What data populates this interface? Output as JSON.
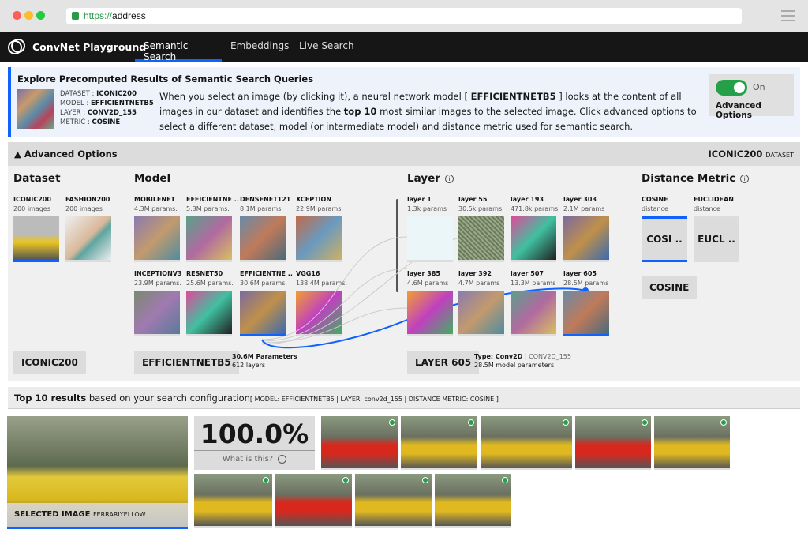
{
  "browser": {
    "url_scheme": "https://",
    "url_host": "address"
  },
  "nav": {
    "brand": "ConvNet Playground",
    "tabs": [
      {
        "label": "Semantic Search",
        "active": true
      },
      {
        "label": "Embeddings"
      },
      {
        "label": "Live Search"
      }
    ]
  },
  "banner": {
    "title": "Explore Precomputed Results of Semantic Search Queries",
    "meta": [
      {
        "k": "DATASET : ",
        "v": "ICONIC200"
      },
      {
        "k": "MODEL : ",
        "v": "EFFICIENTNETB5"
      },
      {
        "k": "LAYER : ",
        "v": "CONV2D_155"
      },
      {
        "k": "METRIC : ",
        "v": "COSINE"
      }
    ],
    "desc1": "When you select an image (by clicking it), a neural network model [ ",
    "desc_model": "EFFICIENTNETB5",
    "desc2": " ] looks at the content of all images in our dataset and identifies the ",
    "desc_top": "top 10",
    "desc3": " most similar images to the selected image. Click advanced options to select a different dataset, model (or intermediate model) and distance metric used for semantic search.",
    "toggle_state": "On",
    "toggle_label": "Advanced Options",
    "toggle_on": true,
    "toggle_color": "#24a148"
  },
  "advanced": {
    "header": "▲ Advanced Options",
    "dataset_value": "ICONIC200",
    "dataset_suffix": "DATASET",
    "dataset": {
      "title": "Dataset",
      "items": [
        {
          "name": "ICONIC200",
          "sub": "200 images",
          "selected": true
        },
        {
          "name": "FASHION200",
          "sub": "200 images"
        }
      ],
      "button": "ICONIC200"
    },
    "model": {
      "title": "Model",
      "items": [
        {
          "name": "MOBILENET",
          "sub": "4.3M params."
        },
        {
          "name": "EFFICIENTNE ..",
          "sub": "5.3M params."
        },
        {
          "name": "DENSENET121",
          "sub": "8.1M params."
        },
        {
          "name": "XCEPTION",
          "sub": "22.9M params."
        },
        {
          "name": "INCEPTIONV3",
          "sub": "23.9M params."
        },
        {
          "name": "RESNET50",
          "sub": "25.6M params."
        },
        {
          "name": "EFFICIENTNE ..",
          "sub": "30.6M params.",
          "selected": true
        },
        {
          "name": "VGG16",
          "sub": "138.4M params."
        }
      ],
      "button": "EFFICIENTNETB5",
      "params": "30.6M Parameters",
      "layers": "612 layers"
    },
    "layer": {
      "title": "Layer",
      "items": [
        {
          "name": "layer 1",
          "sub": "1.3k params"
        },
        {
          "name": "layer 55",
          "sub": "30.5k params"
        },
        {
          "name": "layer 193",
          "sub": "471.8k params"
        },
        {
          "name": "layer 303",
          "sub": "2.1M params"
        },
        {
          "name": "layer 385",
          "sub": "4.6M params"
        },
        {
          "name": "layer 392",
          "sub": "4.7M params"
        },
        {
          "name": "layer 507",
          "sub": "13.3M params"
        },
        {
          "name": "layer 605",
          "sub": "28.5M params",
          "selected": true
        }
      ],
      "button": "LAYER 605",
      "type_label": "Type: Conv2D",
      "type_name": " | CONV2D_155",
      "params": "28.5M model parameters"
    },
    "metric": {
      "title": "Distance Metric",
      "items": [
        {
          "name": "COSINE",
          "sub": "distance",
          "tile": "COSI ..",
          "selected": true
        },
        {
          "name": "EUCLIDEAN",
          "sub": "distance",
          "tile": "EUCL .."
        }
      ],
      "button": "COSINE"
    }
  },
  "results": {
    "bold": "Top 10 results",
    "text": " based on your search configuration",
    "cfg": "[ MODEL: EFFICIENTNETB5 | LAYER: conv2d_155 | DISTANCE METRIC: COSINE ]",
    "selected_label": "SELECTED IMAGE",
    "selected_name": "FERRARIYELLOW",
    "score": "100.0%",
    "what": "What is this?",
    "count": 9
  },
  "colors": {
    "accent": "#0f62fe",
    "nav_bg": "#161616",
    "match": "#24a148"
  }
}
